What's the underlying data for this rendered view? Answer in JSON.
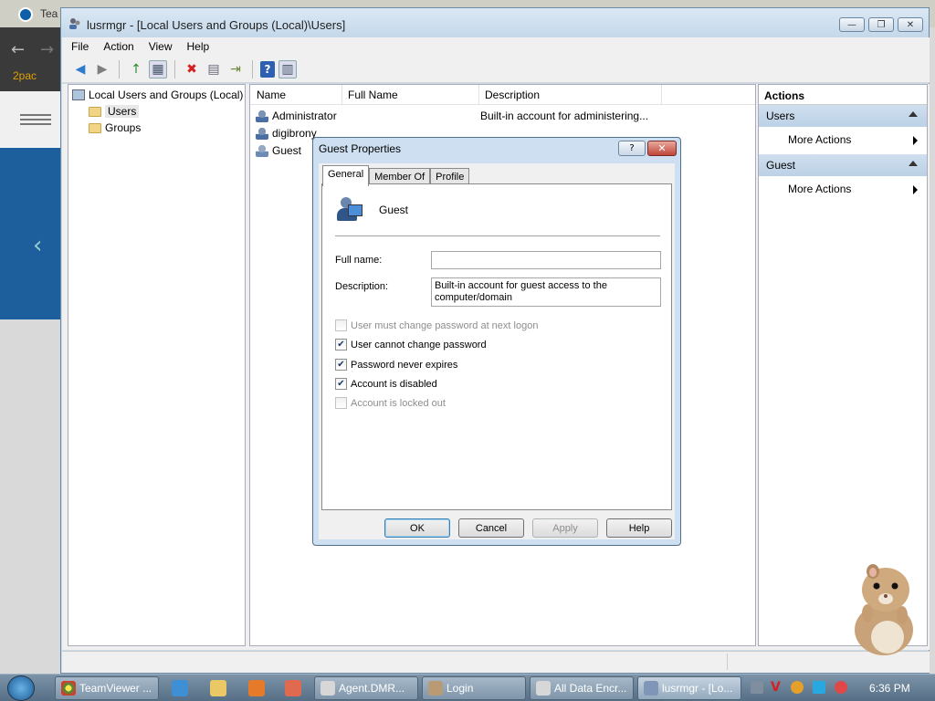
{
  "background": {
    "teamviewer_tab": "Tea",
    "bookmark": "2pac"
  },
  "window": {
    "title": "lusrmgr - [Local Users and Groups (Local)\\Users]",
    "minimize": "—",
    "maximize": "❐",
    "close": "✕"
  },
  "menu": [
    "File",
    "Action",
    "View",
    "Help"
  ],
  "toolbar": {
    "back": "◀",
    "forward": "▶",
    "up": "↑",
    "show_tree": "▦",
    "delete": "✖",
    "properties": "▤",
    "export": "⇥",
    "help": "?",
    "show_action": "▥"
  },
  "tree": {
    "root": "Local Users and Groups (Local)",
    "items": [
      "Users",
      "Groups"
    ]
  },
  "list": {
    "columns": [
      "Name",
      "Full Name",
      "Description"
    ],
    "rows": [
      {
        "name": "Administrator",
        "full_name": "",
        "description": "Built-in account for administering..."
      },
      {
        "name": "digibrony",
        "full_name": "",
        "description": ""
      },
      {
        "name": "Guest",
        "full_name": "",
        "description": ""
      }
    ]
  },
  "actions": {
    "title": "Actions",
    "sections": [
      {
        "label": "Users",
        "item": "More Actions"
      },
      {
        "label": "Guest",
        "item": "More Actions"
      }
    ]
  },
  "dialog": {
    "title": "Guest Properties",
    "help_btn": "?",
    "close_btn": "✕",
    "tabs": [
      "General",
      "Member Of",
      "Profile"
    ],
    "active_tab": "General",
    "username": "Guest",
    "full_name_label": "Full name:",
    "full_name_value": "",
    "description_label": "Description:",
    "description_value": "Built-in account for guest access to the computer/domain",
    "checkboxes": [
      {
        "label": "User must change password at next logon",
        "checked": false,
        "disabled": true
      },
      {
        "label": "User cannot change password",
        "checked": true,
        "disabled": false
      },
      {
        "label": "Password never expires",
        "checked": true,
        "disabled": false
      },
      {
        "label": "Account is disabled",
        "checked": true,
        "disabled": false
      },
      {
        "label": "Account is locked out",
        "checked": false,
        "disabled": true
      }
    ],
    "buttons": {
      "ok": "OK",
      "cancel": "Cancel",
      "apply": "Apply",
      "help": "Help"
    }
  },
  "taskbar": {
    "items": [
      "TeamViewer ...",
      "Agent.DMR...",
      "Login",
      "All Data Encr...",
      "lusrmgr - [Lo..."
    ],
    "clock": "6:36 PM"
  },
  "colors": {
    "accent": "#cddff0",
    "taskbar": "#6a8299",
    "delete_red": "#d42020"
  }
}
